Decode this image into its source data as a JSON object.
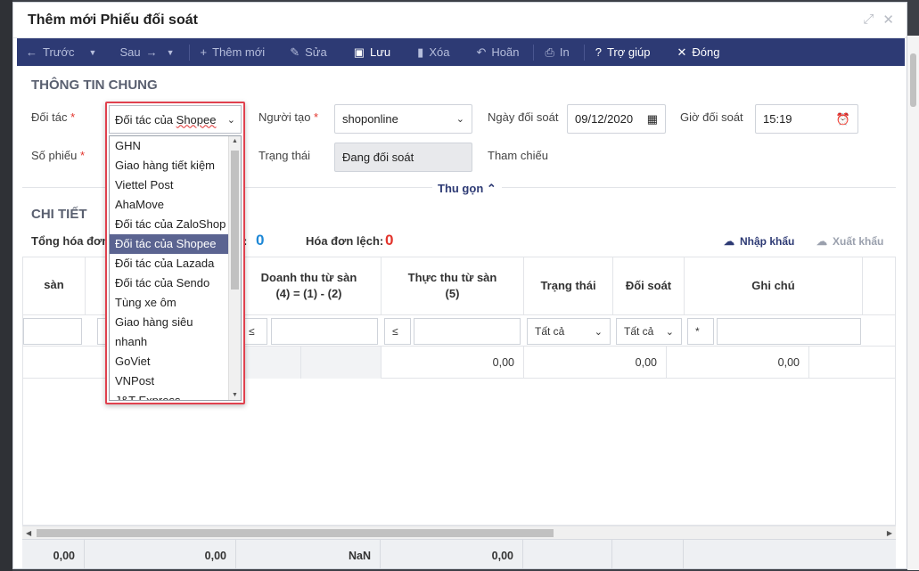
{
  "dialog": {
    "title": "Thêm mới Phiếu đối soát"
  },
  "toolbar": {
    "prev": "Trước",
    "next": "Sau",
    "add": "Thêm mới",
    "edit": "Sửa",
    "save": "Lưu",
    "delete": "Xóa",
    "undo": "Hoãn",
    "print": "In",
    "help": "Trợ giúp",
    "close": "Đóng"
  },
  "general": {
    "title": "THÔNG TIN CHUNG",
    "partner_label": "Đối tác",
    "creator_label": "Người tạo",
    "creator_value": "shoponline",
    "date_label": "Ngày đối soát",
    "date_value": "09/12/2020",
    "time_label": "Giờ đối soát",
    "time_value": "15:19",
    "number_label": "Số phiếu",
    "status_label": "Trạng thái",
    "status_value": "Đang đối soát",
    "ref_label": "Tham chiếu",
    "collapse": "Thu gọn",
    "required_mark": "*"
  },
  "partner_dropdown": {
    "selected_prefix": "Đối tác của ",
    "selected_word": "Shopee",
    "options": [
      "GHN",
      "Giao hàng tiết kiệm",
      "Viettel Post",
      "AhaMove",
      "Đối tác của ZaloShop",
      "Đối tác của Shopee",
      "Đối tác của Lazada",
      "Đối tác của Sendo",
      "Tùng xe ôm",
      "Giao hàng siêu",
      "nhanh",
      "GoViet",
      "VNPost",
      "J&T Express"
    ],
    "selected_index": 5
  },
  "detail": {
    "title": "CHI TIẾT",
    "total_label": "Tổng hóa đơn:",
    "total_colon": ":",
    "total_value": "0",
    "diff_label": "Hóa đơn lệch:",
    "diff_value": "0",
    "import": "Nhập khẩu",
    "export": "Xuất khẩu"
  },
  "grid": {
    "headers": [
      "sàn",
      "Doanh thu từ sàn",
      "(4) = (1) - (2)",
      "Thực thu từ sàn",
      "(5)",
      "Trạng thái",
      "Đối soát",
      "Ghi chú"
    ],
    "filter_ops": [
      "≤",
      "≤",
      "≤",
      "*"
    ],
    "filter_all": "Tất cả",
    "row_values": [
      "0,00",
      "0,00",
      "0,00"
    ],
    "footer_values": [
      "0,00",
      "0,00",
      "NaN",
      "0,00"
    ]
  },
  "colors": {
    "toolbar": "#2d3a74",
    "accent": "#2d3a74",
    "danger": "#e2342c",
    "count_blue": "#1e88d6"
  }
}
